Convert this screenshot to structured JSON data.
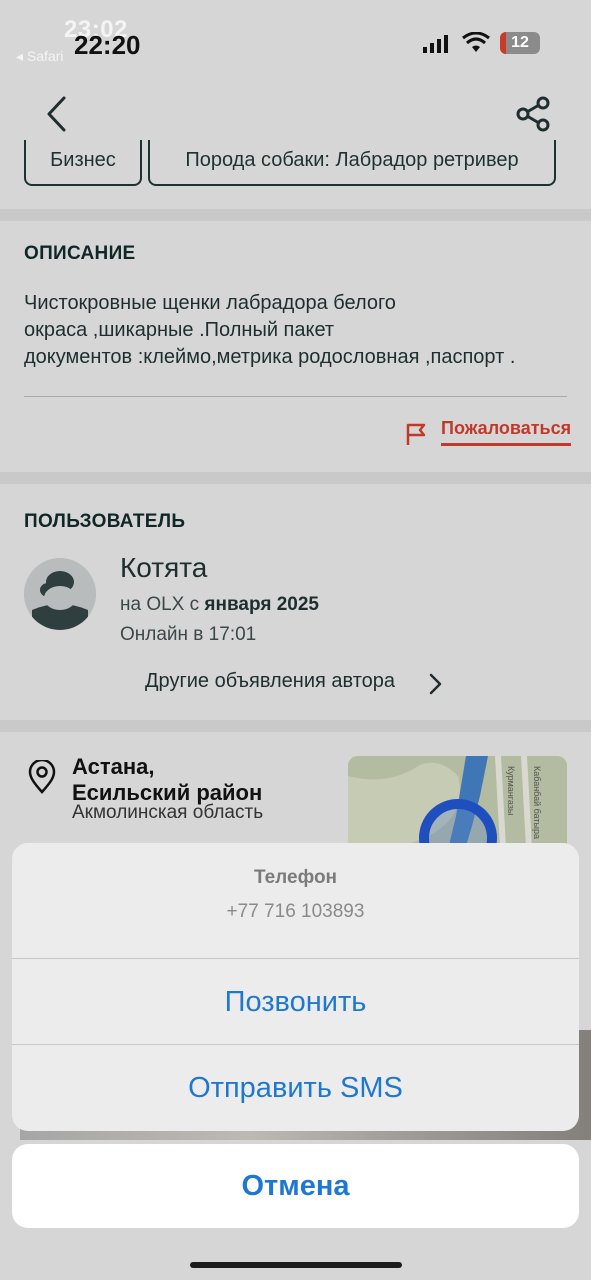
{
  "status_bar": {
    "time_ghost": "23:02",
    "time": "22:20",
    "back_app": "◂ Safari",
    "battery": "12"
  },
  "tags": [
    "Бизнес",
    "Порода собаки: Лабрадор ретривер"
  ],
  "description": {
    "title": "ОПИСАНИЕ",
    "lines": [
      "Чистокровные щенки лабрадора белого",
      "окраса ,шикарные .Полный пакет",
      "документов :клеймо,метрика родословная ,паспорт ."
    ],
    "complain": "Пожаловаться"
  },
  "user": {
    "title": "ПОЛЬЗОВАТЕЛЬ",
    "name": "Котята",
    "since_prefix": "на OLX с ",
    "since_date": "января 2025",
    "online": "Онлайн в 17:01",
    "other_ads": "Другие объявления автора"
  },
  "location": {
    "city_line1": "Астана,",
    "city_line2": "Есильский район",
    "region": "Акмолинская область",
    "map_labels": [
      "Курмангазы",
      "Кабанбай батыра"
    ]
  },
  "sheet": {
    "title": "Телефон",
    "phone": "+77 716 103893",
    "call": "Позвонить",
    "sms": "Отправить SMS",
    "cancel": "Отмена"
  },
  "colors": {
    "accent": "#1f78d0",
    "complain": "#c0392b",
    "text_dark": "#112626"
  }
}
